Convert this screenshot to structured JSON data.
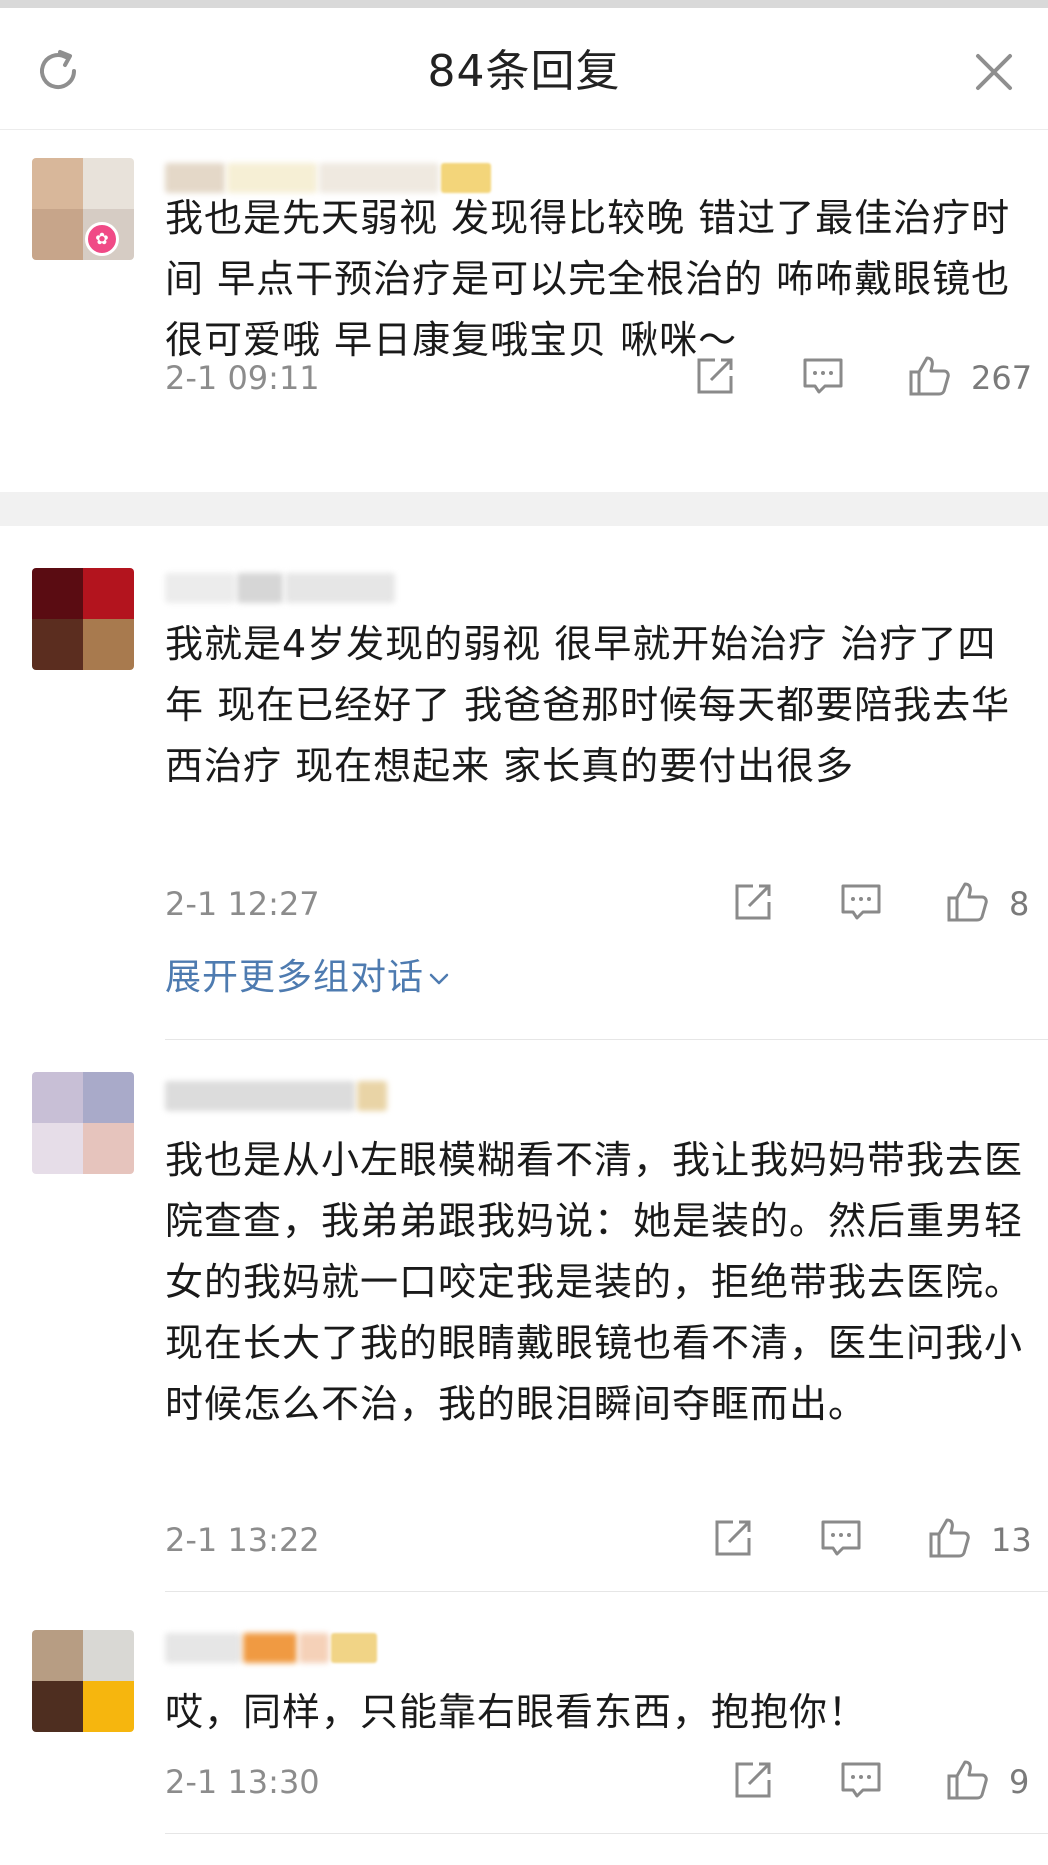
{
  "header": {
    "title": "84条回复",
    "refresh_icon": "refresh-icon",
    "close_icon": "close-icon"
  },
  "comments": [
    {
      "text": "我也是先天弱视 发现得比较晚 错过了最佳治疗时间 早点干预治疗是可以完全根治的 咘咘戴眼镜也很可爱哦 早日康复哦宝贝 啾咪～",
      "time": "2-1 09:11",
      "likes": "267",
      "avatar_colors": [
        "#d8b79a",
        "#e8e2da",
        "#c7a58a",
        "#d6ccc4"
      ]
    },
    {
      "text": "我就是4岁发现的弱视 很早就开始治疗 治疗了四年 现在已经好了 我爸爸那时候每天都要陪我去华西治疗 现在想起来 家长真的要付出很多",
      "time": "2-1 12:27",
      "likes": "8",
      "avatar_colors": [
        "#5a0c12",
        "#b3141e",
        "#5b2d1f",
        "#a87a4e"
      ]
    },
    {
      "text": "我也是从小左眼模糊看不清，我让我妈妈带我去医院查查，我弟弟跟我妈说：她是装的。然后重男轻女的我妈就一口咬定我是装的，拒绝带我去医院。现在长大了我的眼睛戴眼镜也看不清，医生问我小时候怎么不治，我的眼泪瞬间夺眶而出。",
      "time": "2-1 13:22",
      "likes": "13",
      "avatar_colors": [
        "#c8bfd6",
        "#a9aac9",
        "#e6dde8",
        "#e6c4bd"
      ]
    },
    {
      "text": "哎，同样，只能靠右眼看东西，抱抱你！",
      "time": "2-1 13:30",
      "likes": "9",
      "avatar_colors": [
        "#b79d83",
        "#d9d8d4",
        "#4e2e20",
        "#f6b60e"
      ]
    }
  ],
  "expand_link": "展开更多组对话",
  "icons": {
    "share": "share-icon",
    "reply": "comment-icon",
    "like": "thumbs-up-icon",
    "expand": "chevron-down-icon"
  },
  "colors": {
    "link": "#4e7bb0",
    "meta": "#8c8c8c",
    "icon": "#8a8a8a",
    "badge": "#f04a86"
  }
}
